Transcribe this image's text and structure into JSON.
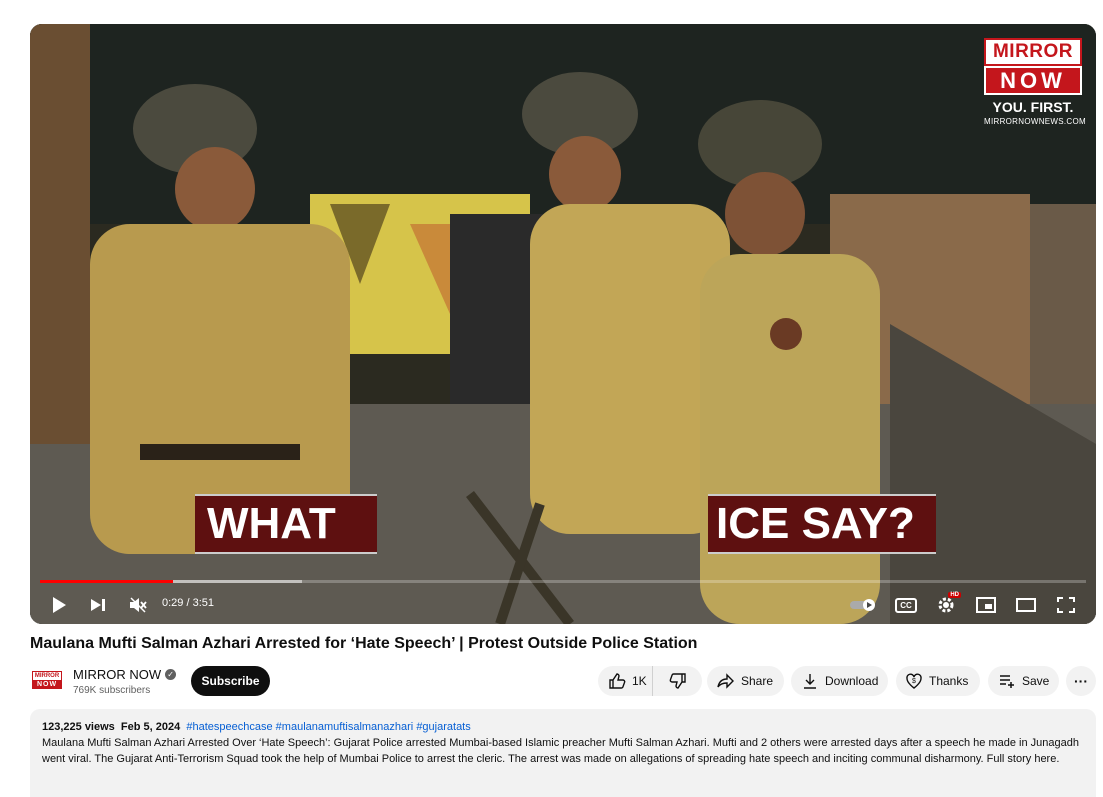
{
  "player": {
    "logo_line1": "MIRROR",
    "logo_line2": "NOW",
    "logo_tagline": "YOU. FIRST.",
    "logo_url": "MIRRORNOWNEWS.COM",
    "banner_left": "WHAT",
    "banner_right": "ICE SAY?",
    "time_display": "0:29 / 3:51",
    "progress": 0.127,
    "buffered": 0.25,
    "cc_label": "CC",
    "hd_badge": "HD"
  },
  "video": {
    "title": "Maulana Mufti Salman Azhari Arrested for ‘Hate Speech’ | Protest Outside Police Station"
  },
  "channel": {
    "avatar_line1": "MIRROR",
    "avatar_line2": "NOW",
    "name": "MIRROR NOW",
    "verified_mark": "✓",
    "subscribers": "769K subscribers",
    "subscribe_label": "Subscribe"
  },
  "actions": {
    "like_count": "1K",
    "share_label": "Share",
    "download_label": "Download",
    "thanks_label": "Thanks",
    "save_label": "Save",
    "more_label": "···"
  },
  "description": {
    "views": "123,225 views",
    "date": "Feb 5, 2024",
    "hashtags": [
      "#hatespeechcase",
      "#maulanamuftisalmanazhari",
      "#gujaratats"
    ],
    "text": "Maulana Mufti Salman Azhari Arrested Over ‘Hate Speech’: Gujarat Police arrested Mumbai-based Islamic preacher Mufti Salman Azhari. Mufti and 2 others were arrested days after a speech he made in Junagadh went viral. The Gujarat Anti-Terrorism Squad took the help of Mumbai Police to arrest the cleric. The arrest was made on allegations of spreading hate speech and inciting communal disharmony. Full story here."
  },
  "colors": {
    "brand_red": "#c4161c",
    "progress_red": "#ff0000",
    "link_blue": "#065fd4",
    "pill_bg": "#f2f2f2"
  },
  "icons": [
    "play-icon",
    "next-icon",
    "mute-icon",
    "autoplay-icon",
    "cc-icon",
    "settings-icon",
    "miniplayer-icon",
    "theater-icon",
    "fullscreen-icon",
    "like-icon",
    "dislike-icon",
    "share-icon",
    "download-icon",
    "thanks-icon",
    "save-icon",
    "more-icon"
  ]
}
